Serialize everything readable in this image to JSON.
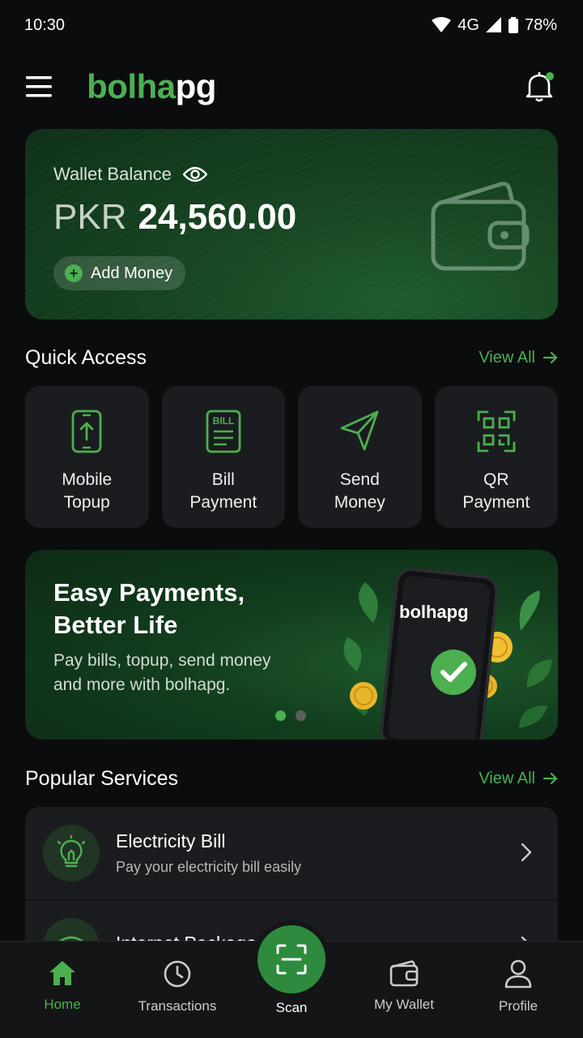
{
  "status_bar": {
    "time": "10:30",
    "network": "4G",
    "battery": "78%"
  },
  "header": {
    "logo_part1": "bolha",
    "logo_part2": "pg",
    "menu_icon": "hamburger-menu-icon",
    "bell_icon": "bell-icon"
  },
  "wallet": {
    "title": "Wallet Balance",
    "currency": "PKR",
    "amount": "24,560.00",
    "add_money_label": "Add Money"
  },
  "quick_access": {
    "title": "Quick Access",
    "view_all": "View All",
    "items": [
      {
        "label": "Mobile\nTopup",
        "icon": "mobile-topup-icon"
      },
      {
        "label": "Bill\nPayment",
        "icon": "bill-icon"
      },
      {
        "label": "Send\nMoney",
        "icon": "send-icon"
      },
      {
        "label": "QR\nPayment",
        "icon": "qr-icon"
      }
    ]
  },
  "promo": {
    "title": "Easy Payments,\nBetter Life",
    "subtitle": "Pay bills, topup, send money\nand more with bolhapg.",
    "phone_logo_part1": "bolha",
    "phone_logo_part2": "pg",
    "active_slide": 1,
    "slide_count": 2
  },
  "popular_services": {
    "title": "Popular Services",
    "view_all": "View All",
    "items": [
      {
        "title": "Electricity Bill",
        "subtitle": "Pay your electricity bill easily",
        "icon": "lightbulb-icon"
      },
      {
        "title": "Internet Packages",
        "subtitle": "",
        "icon": "wifi-icon"
      }
    ]
  },
  "bottom_nav": {
    "items": [
      {
        "label": "Home",
        "icon": "home-icon",
        "active": true
      },
      {
        "label": "Transactions",
        "icon": "clock-icon",
        "active": false
      },
      {
        "label": "Scan",
        "icon": "scan-icon",
        "active": false
      },
      {
        "label": "My Wallet",
        "icon": "wallet-icon",
        "active": false
      },
      {
        "label": "Profile",
        "icon": "profile-icon",
        "active": false
      }
    ]
  },
  "colors": {
    "accent": "#4caf50",
    "background": "#0b0c0e",
    "card": "#1a1c1f"
  }
}
